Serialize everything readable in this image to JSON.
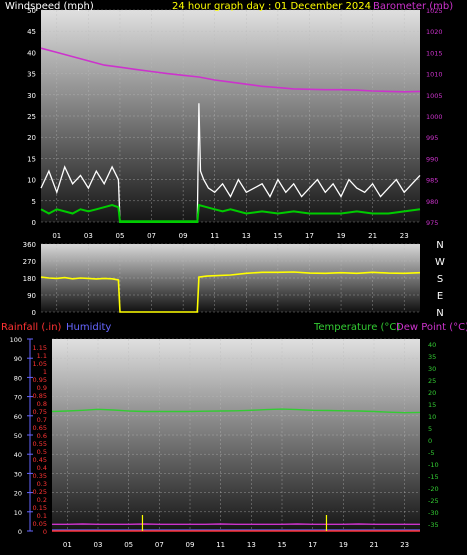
{
  "header": {
    "wind_title": "Windspeed (mph)",
    "graph_title": "24 hour graph day : 01 December 2024",
    "baro_title": "Barometer (mb)"
  },
  "footer_labels": {
    "rain": "Rainfall (.in)",
    "humidity": "Humidity",
    "temp": "Temperature (°C)",
    "dew": "Dew Point (°C)"
  },
  "compass": [
    "N",
    "W",
    "S",
    "E",
    "N"
  ],
  "colors": {
    "wind_avg": "#00cc00",
    "wind_gust": "#ffffff",
    "baro": "#cc33cc",
    "direction": "#ffff00",
    "temp": "#33cc33",
    "dew": "#cc33cc",
    "rain": "#ff3333",
    "humidity": "#6666ff",
    "title_yellow": "#ffff00",
    "grid": "#bbbbbb"
  },
  "chart_data": [
    {
      "type": "line",
      "title": "24 hour graph day : 01 December 2024",
      "x_ticks": [
        "01",
        "03",
        "05",
        "07",
        "09",
        "11",
        "13",
        "15",
        "17",
        "19",
        "21",
        "23"
      ],
      "xlim": [
        0,
        24
      ],
      "y_left": {
        "label": "Windspeed (mph)",
        "ticks": [
          "0",
          "5",
          "10",
          "15",
          "20",
          "25",
          "30",
          "35",
          "40",
          "45",
          "50"
        ],
        "lim": [
          0,
          50
        ]
      },
      "y_right": {
        "label": "Barometer (mb)",
        "ticks": [
          "975",
          "980",
          "985",
          "990",
          "995",
          "1000",
          "1005",
          "1010",
          "1015",
          "1020",
          "1025"
        ],
        "lim": [
          975,
          1025
        ]
      },
      "series": [
        {
          "name": "Barometer (mb)",
          "axis": "right",
          "x": [
            0,
            1,
            2,
            3,
            4,
            5,
            6,
            7,
            8,
            9,
            10,
            11,
            12,
            13,
            14,
            15,
            16,
            17,
            18,
            19,
            20,
            21,
            22,
            23,
            24
          ],
          "y": [
            1016,
            1015,
            1014,
            1013,
            1012,
            1011.5,
            1011,
            1010.5,
            1010,
            1009.6,
            1009.2,
            1008.5,
            1008,
            1007.5,
            1007,
            1006.7,
            1006.4,
            1006.3,
            1006.2,
            1006.2,
            1006.1,
            1005.9,
            1005.8,
            1005.7,
            1005.8
          ]
        },
        {
          "name": "Wind gust (mph)",
          "axis": "left",
          "x": [
            0,
            0.5,
            1,
            1.5,
            2,
            2.5,
            3,
            3.5,
            4,
            4.5,
            4.9,
            5,
            9.9,
            10,
            10.1,
            10.3,
            10.6,
            11,
            11.5,
            12,
            12.5,
            13,
            13.5,
            14,
            14.5,
            15,
            15.5,
            16,
            16.5,
            17,
            17.5,
            18,
            18.5,
            19,
            19.5,
            20,
            20.5,
            21,
            21.5,
            22,
            22.5,
            23,
            23.5,
            24
          ],
          "y": [
            8,
            12,
            7,
            13,
            9,
            11,
            8,
            12,
            9,
            13,
            10,
            0,
            0,
            28,
            12,
            10,
            8,
            7,
            9,
            6,
            10,
            7,
            8,
            9,
            6,
            10,
            7,
            9,
            6,
            8,
            10,
            7,
            9,
            6,
            10,
            8,
            7,
            9,
            6,
            8,
            10,
            7,
            9,
            11
          ]
        },
        {
          "name": "Wind average (mph)",
          "axis": "left",
          "x": [
            0,
            0.5,
            1,
            1.5,
            2,
            2.5,
            3,
            3.5,
            4,
            4.5,
            4.9,
            5,
            9.9,
            10,
            10.5,
            11,
            11.5,
            12,
            13,
            14,
            15,
            16,
            17,
            18,
            19,
            20,
            21,
            22,
            23,
            24
          ],
          "y": [
            3,
            2,
            3,
            2.5,
            2,
            3,
            2.5,
            3,
            3.5,
            4,
            3.5,
            0,
            0,
            4,
            3.5,
            3,
            2.5,
            3,
            2,
            2.5,
            2,
            2.5,
            2,
            2,
            2,
            2.5,
            2,
            2,
            2.5,
            3
          ]
        }
      ]
    },
    {
      "type": "line",
      "title": "",
      "x_ticks": [],
      "xlim": [
        0,
        24
      ],
      "y_left": {
        "label": "",
        "ticks": [
          "0",
          "90",
          "180",
          "270",
          "360"
        ],
        "lim": [
          0,
          360
        ]
      },
      "series": [
        {
          "name": "Wind direction (°)",
          "axis": "left",
          "x": [
            0,
            0.5,
            1,
            1.5,
            2,
            2.5,
            3,
            3.5,
            4,
            4.5,
            4.9,
            5,
            9.9,
            10,
            10.5,
            11,
            12,
            13,
            14,
            15,
            16,
            17,
            18,
            19,
            20,
            21,
            22,
            23,
            24
          ],
          "y": [
            185,
            180,
            178,
            182,
            176,
            180,
            178,
            175,
            178,
            176,
            170,
            0,
            0,
            185,
            190,
            192,
            196,
            205,
            210,
            210,
            212,
            206,
            205,
            208,
            205,
            210,
            206,
            205,
            208
          ]
        }
      ]
    },
    {
      "type": "line",
      "title": "",
      "x_ticks": [
        "01",
        "03",
        "05",
        "07",
        "09",
        "11",
        "13",
        "15",
        "17",
        "19",
        "21",
        "23"
      ],
      "xlim": [
        0,
        24
      ],
      "y_left": {
        "label": "Rainfall (.in)",
        "ticks": [
          "0",
          "0.05",
          "0.1",
          "0.15",
          "0.2",
          "0.25",
          "0.3",
          "0.35",
          "0.4",
          "0.45",
          "0.5",
          "0.55",
          "0.6",
          "0.65",
          "0.7",
          "0.75",
          "0.8",
          "0.85",
          "0.9",
          "0.95",
          "1",
          "1.05",
          "1.1",
          "1.15"
        ],
        "lim": [
          0,
          1.2
        ]
      },
      "y_humidity": {
        "label": "Humidity",
        "ticks": [
          "0",
          "10",
          "20",
          "30",
          "40",
          "50",
          "60",
          "70",
          "80",
          "90",
          "100"
        ],
        "lim": [
          0,
          100
        ]
      },
      "y_right": {
        "label": "Temperature (°C)",
        "ticks": [
          "-35",
          "-30",
          "-25",
          "-20",
          "-15",
          "-10",
          "-5",
          "0",
          "5",
          "10",
          "15",
          "20",
          "25",
          "30",
          "35",
          "40"
        ],
        "lim": [
          -38,
          42
        ]
      },
      "series": [
        {
          "name": "Temperature (°C)",
          "axis": "right",
          "x": [
            0,
            1,
            2,
            3,
            4,
            5,
            6,
            7,
            8,
            9,
            10,
            11,
            12,
            13,
            14,
            15,
            16,
            17,
            18,
            19,
            20,
            21,
            22,
            23,
            24
          ],
          "y": [
            11.8,
            12,
            12.3,
            12.7,
            12.4,
            12,
            11.8,
            11.8,
            11.8,
            11.8,
            11.9,
            12,
            12.1,
            12.3,
            12.6,
            12.8,
            12.6,
            12.3,
            12.2,
            12.1,
            12,
            11.8,
            11.5,
            11.3,
            11.4
          ]
        },
        {
          "name": "Dew Point (°C)",
          "axis": "right",
          "x": [
            0,
            1,
            2,
            3,
            4,
            5,
            6,
            7,
            8,
            9,
            10,
            11,
            12,
            13,
            14,
            15,
            16,
            17,
            18,
            19,
            20,
            21,
            22,
            23,
            24
          ],
          "y": [
            -35.2,
            -35.2,
            -35.1,
            -35.2,
            -35.2,
            -35.2,
            -35.1,
            -35.2,
            -35.2,
            -35.2,
            -35.2,
            -35.1,
            -35.2,
            -35.2,
            -35.2,
            -35.2,
            -35.1,
            -35.2,
            -35.2,
            -35.2,
            -35.1,
            -35.2,
            -35.2,
            -35.2,
            -35.2
          ]
        },
        {
          "name": "Humidity",
          "axis": "humidity",
          "x": [
            0,
            6,
            12,
            18,
            24
          ],
          "y": [
            0.5,
            0.5,
            0.5,
            0.5,
            0.5
          ]
        },
        {
          "name": "Rainfall (.in)",
          "axis": "left",
          "x": [
            0,
            6,
            12,
            18,
            24
          ],
          "y": [
            0,
            0,
            0,
            0,
            0
          ]
        }
      ],
      "markers": {
        "name": "Rain tips",
        "x": [
          5.9,
          17.9
        ],
        "y_in": [
          0.1,
          0.1
        ]
      }
    }
  ]
}
